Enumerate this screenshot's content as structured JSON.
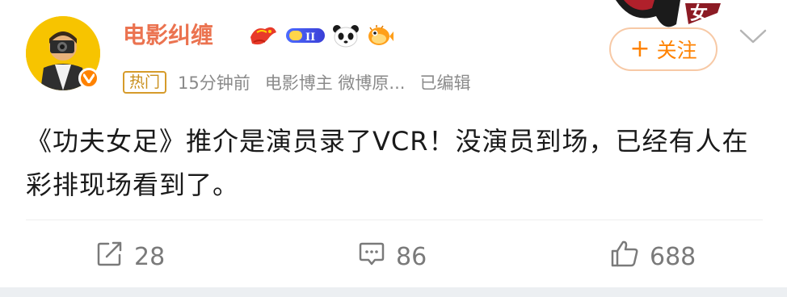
{
  "post": {
    "author": {
      "name": "电影纠缠",
      "verified": true,
      "badge_level": "II"
    },
    "meta": {
      "tag": "热门",
      "time": "15分钟前",
      "source": "电影博主 微博原...",
      "edited": "已编辑"
    },
    "follow_button": {
      "plus": "+",
      "label": "关注"
    },
    "content": "《功夫女足》推介是演员录了VCR！没演员到场，已经有人在彩排现场看到了。",
    "actions": {
      "repost_count": "28",
      "comment_count": "86",
      "like_count": "688"
    }
  },
  "colors": {
    "username": "#eb7350",
    "accent": "#ff8200",
    "meta_text": "#8a8a8a",
    "hot_tag": "#d69b2a"
  },
  "icons": [
    "dragon-badge-icon",
    "level-badge-icon",
    "panda-icon",
    "pufferfish-icon",
    "verified-v-icon",
    "chevron-down-icon",
    "repost-icon",
    "comment-icon",
    "like-icon"
  ]
}
